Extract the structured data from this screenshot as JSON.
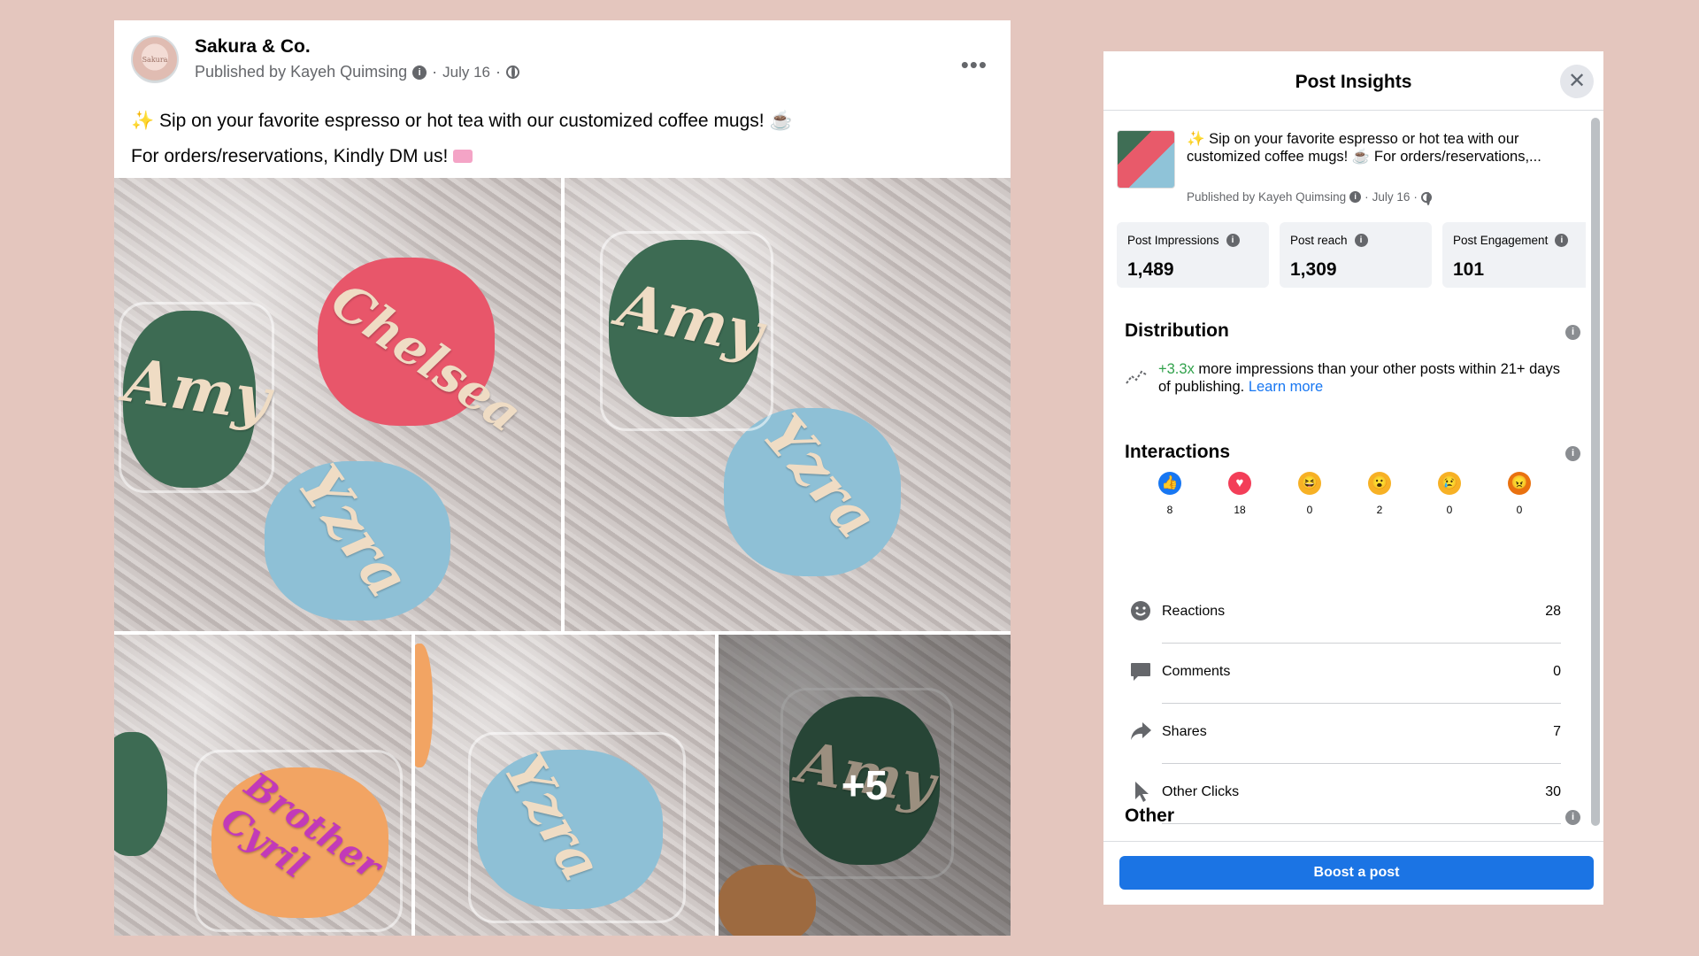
{
  "post": {
    "page_name": "Sakura & Co.",
    "published_by": "Published by Kayeh Quimsing",
    "date": "July 16",
    "caption_line1": "Sip on your favorite espresso or hot tea with our customized coffee mugs!",
    "caption_line2": "For orders/reservations, Kindly DM us!",
    "more_photos_label": "+5",
    "photo_names": [
      "Amy",
      "Chelsea",
      "Yzra",
      "Amy",
      "Yzra",
      "Brother Cyril",
      "Yzra",
      "Amy"
    ]
  },
  "insights": {
    "title": "Post Insights",
    "preview_text": "Sip on your favorite espresso or hot tea with our customized coffee mugs! ☕ For orders/reservations,...",
    "preview_meta": "Published by Kayeh Quimsing",
    "preview_date": "July 16",
    "stats": [
      {
        "label": "Post Impressions",
        "value": "1,489"
      },
      {
        "label": "Post reach",
        "value": "1,309"
      },
      {
        "label": "Post Engagement",
        "value": "101"
      }
    ],
    "distribution": {
      "title": "Distribution",
      "highlight": "+3.3x",
      "text": " more impressions than your other posts within 21+ days of publishing. ",
      "link": "Learn more"
    },
    "interactions": {
      "title": "Interactions",
      "reactions": [
        {
          "type": "like",
          "count": "8",
          "color": "#1877f2",
          "icon": "thumbs-up-icon"
        },
        {
          "type": "love",
          "count": "18",
          "color": "#f33e58",
          "icon": "heart-icon"
        },
        {
          "type": "haha",
          "count": "0",
          "color": "#f7b125",
          "icon": "laughing-face-icon"
        },
        {
          "type": "wow",
          "count": "2",
          "color": "#f7b125",
          "icon": "surprised-face-icon"
        },
        {
          "type": "sad",
          "count": "0",
          "color": "#f7b125",
          "icon": "sad-face-icon"
        },
        {
          "type": "angry",
          "count": "0",
          "color": "#e9710f",
          "icon": "angry-face-icon"
        }
      ],
      "metrics": [
        {
          "label": "Reactions",
          "value": "28",
          "icon": "smiley-icon"
        },
        {
          "label": "Comments",
          "value": "0",
          "icon": "comment-bubble-icon"
        },
        {
          "label": "Shares",
          "value": "7",
          "icon": "share-arrow-icon"
        },
        {
          "label": "Other Clicks",
          "value": "30",
          "icon": "cursor-icon"
        }
      ]
    },
    "other_title": "Other",
    "boost_label": "Boost a post"
  },
  "colors": {
    "background": "#e4c6be",
    "accent": "#1b74e4",
    "positive": "#31a24c"
  }
}
